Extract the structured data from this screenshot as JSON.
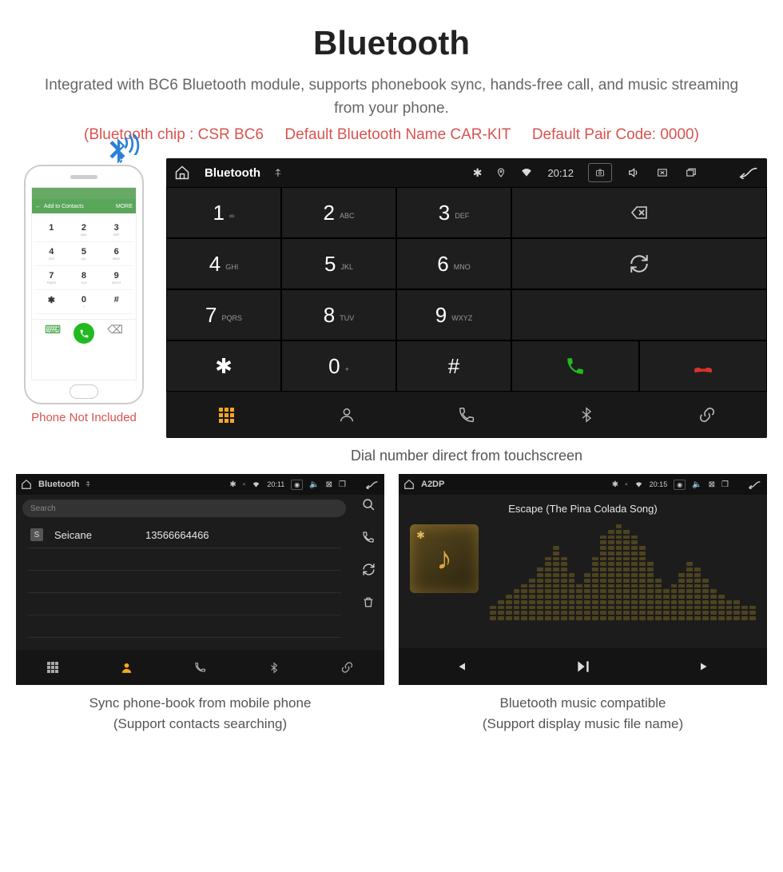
{
  "header": {
    "title": "Bluetooth",
    "subtitle": "Integrated with BC6 Bluetooth module, supports phonebook sync, hands-free call, and music streaming from your phone.",
    "spec_chip": "(Bluetooth chip : CSR BC6",
    "spec_name": "Default Bluetooth Name CAR-KIT",
    "spec_code": "Default Pair Code: 0000)"
  },
  "phone": {
    "note": "Phone Not Included",
    "top_add": "Add to Contacts",
    "top_more": "MORE",
    "keys": [
      {
        "d": "1",
        "s": ""
      },
      {
        "d": "2",
        "s": "ABC"
      },
      {
        "d": "3",
        "s": "DEF"
      },
      {
        "d": "4",
        "s": "GHI"
      },
      {
        "d": "5",
        "s": "JKL"
      },
      {
        "d": "6",
        "s": "MNO"
      },
      {
        "d": "7",
        "s": "PQRS"
      },
      {
        "d": "8",
        "s": "TUV"
      },
      {
        "d": "9",
        "s": "WXYZ"
      },
      {
        "d": "✱",
        "s": ""
      },
      {
        "d": "0",
        "s": "+"
      },
      {
        "d": "#",
        "s": ""
      }
    ]
  },
  "headunit": {
    "title": "Bluetooth",
    "time": "20:12",
    "keypad": [
      {
        "d": "1",
        "s": "∞"
      },
      {
        "d": "2",
        "s": "ABC"
      },
      {
        "d": "3",
        "s": "DEF"
      },
      {
        "d": "4",
        "s": "GHI"
      },
      {
        "d": "5",
        "s": "JKL"
      },
      {
        "d": "6",
        "s": "MNO"
      },
      {
        "d": "7",
        "s": "PQRS"
      },
      {
        "d": "8",
        "s": "TUV"
      },
      {
        "d": "9",
        "s": "WXYZ"
      },
      {
        "d": "✱",
        "s": ""
      },
      {
        "d": "0",
        "s": "+"
      },
      {
        "d": "#",
        "s": ""
      }
    ],
    "caption": "Dial number direct from touchscreen"
  },
  "contacts": {
    "title": "Bluetooth",
    "time": "20:11",
    "search_placeholder": "Search",
    "item": {
      "initial": "S",
      "name": "Seicane",
      "number": "13566664466"
    },
    "caption_l1": "Sync phone-book from mobile phone",
    "caption_l2": "(Support contacts searching)"
  },
  "music": {
    "title": "A2DP",
    "time": "20:15",
    "track": "Escape (The Pina Colada Song)",
    "caption_l1": "Bluetooth music compatible",
    "caption_l2": "(Support display music file name)"
  }
}
